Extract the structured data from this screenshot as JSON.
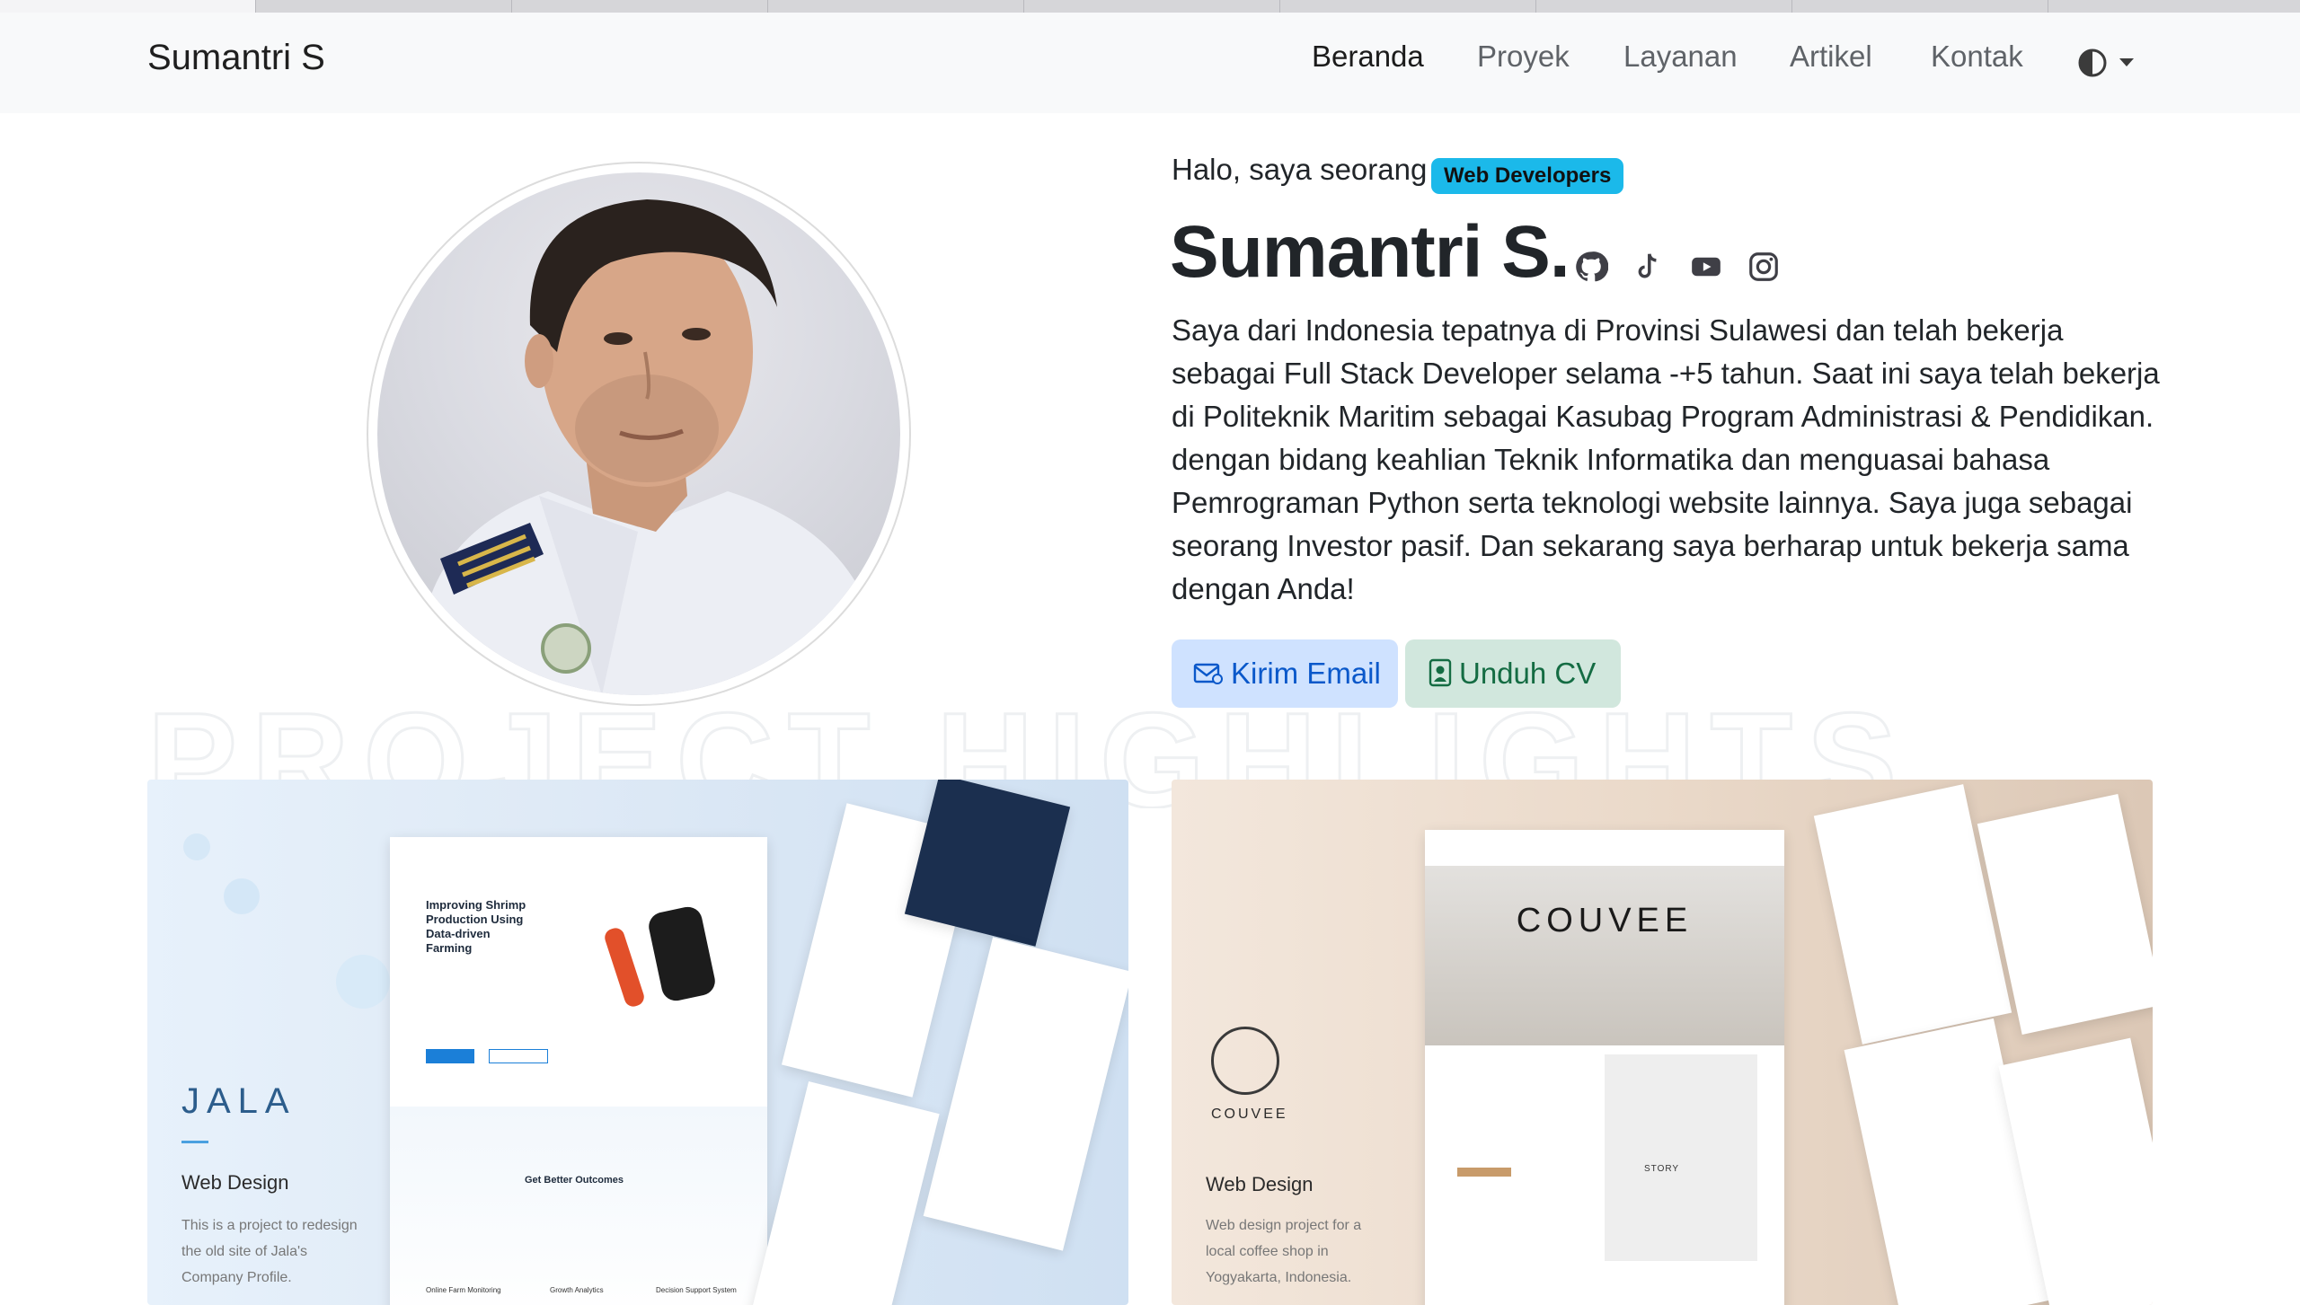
{
  "browser": {
    "tab_count": 9
  },
  "navbar": {
    "brand": "Sumantri S",
    "links": [
      "Beranda",
      "Proyek",
      "Layanan",
      "Artikel",
      "Kontak"
    ],
    "active_link": "Beranda",
    "theme_icon": "half-circle-contrast-icon"
  },
  "hero": {
    "greeting": "Halo, saya seorang",
    "role": "Web Developers",
    "name": "Sumantri S.",
    "social_icons": [
      "github-icon",
      "tiktok-icon",
      "youtube-icon",
      "instagram-icon"
    ],
    "bio": "Saya dari Indonesia tepatnya di Provinsi Sulawesi dan telah bekerja sebagai Full Stack Developer selama -+5 tahun. Saat ini saya telah bekerja di Politeknik Maritim sebagai Kasubag Program Administrasi & Pendidikan. dengan bidang keahlian Teknik Informatika dan menguasai bahasa Pemrograman Python serta teknologi website lainnya. Saya juga sebagai seorang Investor pasif. Dan sekarang saya berharap untuk bekerja sama dengan Anda!",
    "buttons": {
      "email": "Kirim Email",
      "cv": "Unduh CV"
    }
  },
  "projects": [
    {
      "logo": "JALA",
      "category": "Web Design",
      "description": "This is a project to redesign the old site of Jala's Company Profile.",
      "mockup_headline": "Improving Shrimp Production Using Data-driven Farming",
      "mockup_section": "Get Better Outcomes",
      "mockup_features": [
        "Online Farm Monitoring",
        "Growth Analytics",
        "Decision Support System"
      ]
    },
    {
      "logo": "COUVEE",
      "category": "Web Design",
      "description": "Web design project for a local coffee shop in Yogyakarta, Indonesia.",
      "mockup_headline": "COUVEE",
      "mockup_section": "STORY"
    }
  ],
  "colors": {
    "navbar_bg": "#f8f9fa",
    "badge_bg": "#1bb9ea",
    "email_btn_bg": "#cfe2ff",
    "email_btn_text": "#0a58ca",
    "cv_btn_bg": "#d1e7dd",
    "cv_btn_text": "#146c43"
  }
}
